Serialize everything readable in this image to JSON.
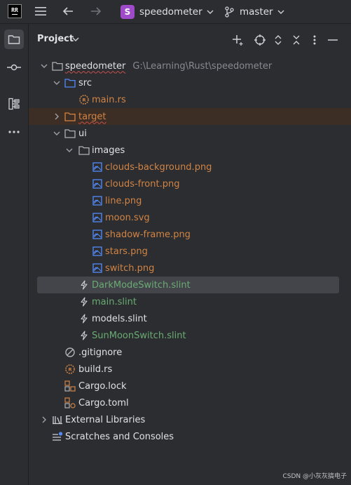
{
  "window": {
    "app_logo_text": "RR",
    "project_name": "speedometer",
    "project_badge": "S",
    "branch_name": "master"
  },
  "panel": {
    "title": "Project"
  },
  "tree": {
    "root": {
      "label": "speedometer",
      "path_hint": "G:\\Learning\\Rust\\speedometer"
    },
    "src": "src",
    "main_rs": "main.rs",
    "target": "target",
    "ui": "ui",
    "images": "images",
    "image_files": [
      "clouds-background.png",
      "clouds-front.png",
      "line.png",
      "moon.svg",
      "shadow-frame.png",
      "stars.png",
      "switch.png"
    ],
    "slint_files": [
      "DarkModeSwitch.slint",
      "main.slint",
      "models.slint",
      "SunMoonSwitch.slint"
    ],
    "gitignore": ".gitignore",
    "build_rs": "build.rs",
    "cargo_lock": "Cargo.lock",
    "cargo_toml": "Cargo.toml",
    "external_libraries": "External Libraries",
    "scratches": "Scratches and Consoles"
  },
  "colors": {
    "background": "#2b2d30",
    "selection": "#43454a",
    "excluded_row": "#3c2e24",
    "untracked_file": "#d28445",
    "new_file": "#6aab73",
    "folder_icon": "#afb1b3",
    "source_folder_icon": "#548af7"
  },
  "watermark": "CSDN @小灰灰搞电子"
}
